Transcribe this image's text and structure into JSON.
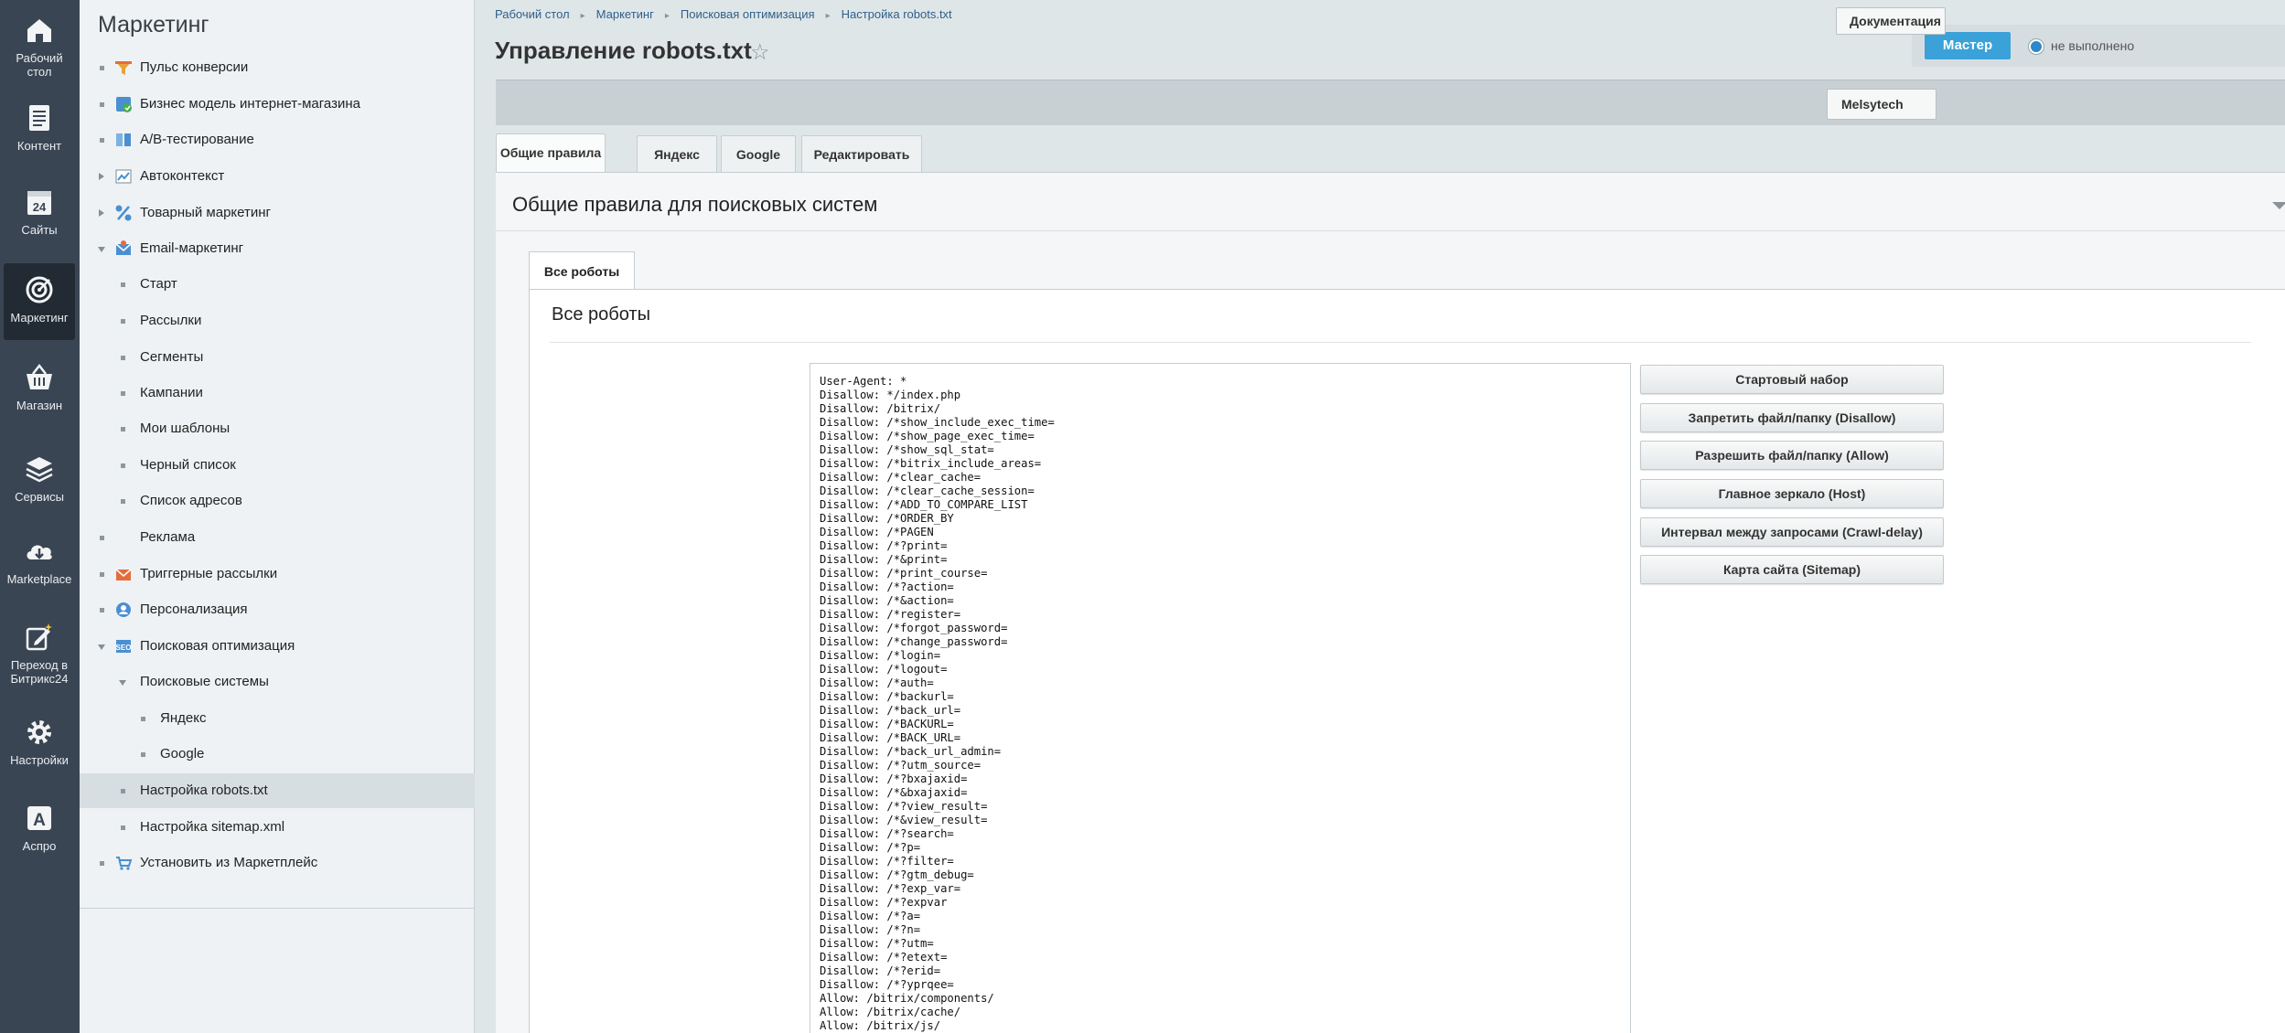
{
  "rail": [
    {
      "label": "Рабочий стол",
      "icon": "home-icon"
    },
    {
      "label": "Контент",
      "icon": "document-icon"
    },
    {
      "label": "Сайты",
      "icon": "calendar-24-icon"
    },
    {
      "label": "Маркетинг",
      "icon": "target-icon"
    },
    {
      "label": "Магазин",
      "icon": "basket-icon"
    },
    {
      "label": "Сервисы",
      "icon": "layers-icon"
    },
    {
      "label": "Marketplace",
      "icon": "cloud-download-icon"
    },
    {
      "label": "Переход в Битрикс24",
      "icon": "edit-star-icon"
    },
    {
      "label": "Настройки",
      "icon": "gear-icon"
    },
    {
      "label": "Аспро",
      "icon": "letter-a-icon"
    }
  ],
  "menu": {
    "title": "Маркетинг",
    "items": [
      {
        "label": "Пульс конверсии"
      },
      {
        "label": "Бизнес модель интернет-магазина"
      },
      {
        "label": "А/В-тестирование"
      },
      {
        "label": "Автоконтекст"
      },
      {
        "label": "Товарный маркетинг"
      },
      {
        "label": "Email-маркетинг"
      },
      {
        "label": "Старт"
      },
      {
        "label": "Рассылки"
      },
      {
        "label": "Сегменты"
      },
      {
        "label": "Кампании"
      },
      {
        "label": "Мои шаблоны"
      },
      {
        "label": "Черный список"
      },
      {
        "label": "Список адресов"
      },
      {
        "label": "Реклама"
      },
      {
        "label": "Триггерные рассылки"
      },
      {
        "label": "Персонализация"
      },
      {
        "label": "Поисковая оптимизация"
      },
      {
        "label": "Поисковые системы"
      },
      {
        "label": "Яндекс"
      },
      {
        "label": "Google"
      },
      {
        "label": "Настройка robots.txt"
      },
      {
        "label": "Настройка sitemap.xml"
      },
      {
        "label": "Установить из Маркетплейс"
      }
    ]
  },
  "breadcrumb": [
    "Рабочий стол",
    "Маркетинг",
    "Поисковая оптимизация",
    "Настройка robots.txt"
  ],
  "page_title": "Управление robots.txt",
  "master": {
    "button": "Мастер",
    "status": "не выполнено"
  },
  "docs_button": "Документация",
  "company_button": "Melsytech",
  "tabs": [
    "Общие правила",
    "Яндекс",
    "Google",
    "Редактировать"
  ],
  "section_title": "Общие правила для поисковых систем",
  "inner_tab": "Все роботы",
  "robots_title": "Все роботы",
  "robots_content": "User-Agent: *\nDisallow: */index.php\nDisallow: /bitrix/\nDisallow: /*show_include_exec_time=\nDisallow: /*show_page_exec_time=\nDisallow: /*show_sql_stat=\nDisallow: /*bitrix_include_areas=\nDisallow: /*clear_cache=\nDisallow: /*clear_cache_session=\nDisallow: /*ADD_TO_COMPARE_LIST\nDisallow: /*ORDER_BY\nDisallow: /*PAGEN\nDisallow: /*?print=\nDisallow: /*&print=\nDisallow: /*print_course=\nDisallow: /*?action=\nDisallow: /*&action=\nDisallow: /*register=\nDisallow: /*forgot_password=\nDisallow: /*change_password=\nDisallow: /*login=\nDisallow: /*logout=\nDisallow: /*auth=\nDisallow: /*backurl=\nDisallow: /*back_url=\nDisallow: /*BACKURL=\nDisallow: /*BACK_URL=\nDisallow: /*back_url_admin=\nDisallow: /*?utm_source=\nDisallow: /*?bxajaxid=\nDisallow: /*&bxajaxid=\nDisallow: /*?view_result=\nDisallow: /*&view_result=\nDisallow: /*?search=\nDisallow: /*?p=\nDisallow: /*?filter=\nDisallow: /*?gtm_debug=\nDisallow: /*?exp_var=\nDisallow: /*?expvar\nDisallow: /*?a=\nDisallow: /*?n=\nDisallow: /*?utm=\nDisallow: /*?etext=\nDisallow: /*?erid=\nDisallow: /*?yprqee=\nAllow: /bitrix/components/\nAllow: /bitrix/cache/\nAllow: /bitrix/js/",
  "actions": [
    "Стартовый набор",
    "Запретить файл/папку (Disallow)",
    "Разрешить файл/папку (Allow)",
    "Главное зеркало (Host)",
    "Интервал между запросами (Crawl-delay)",
    "Карта сайта (Sitemap)"
  ],
  "colors": {
    "accent": "#3aa1d9",
    "rail": "#3a4553",
    "rail_active": "#222a33"
  }
}
